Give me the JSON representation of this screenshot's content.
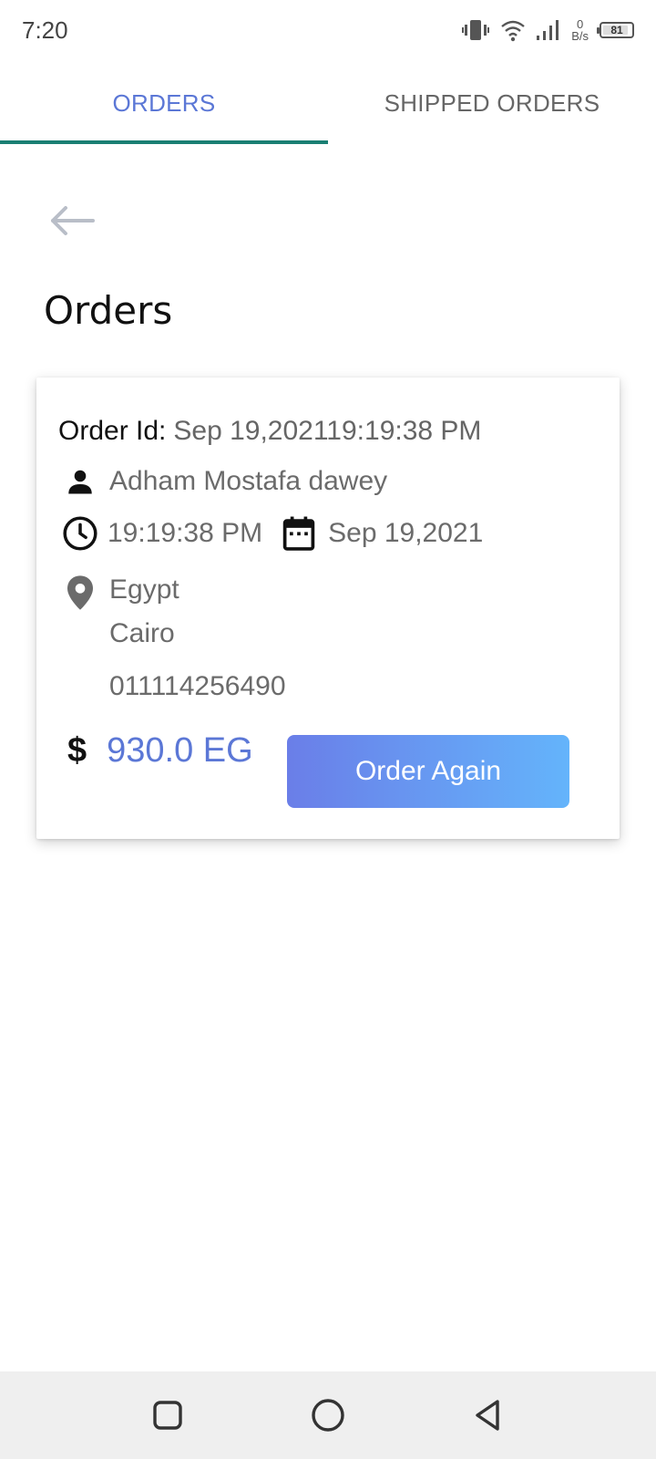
{
  "status_bar": {
    "time": "7:20",
    "net_speed_value": "0",
    "net_speed_unit": "B/s",
    "battery_level": "81"
  },
  "tabs": [
    {
      "label": "ORDERS",
      "active": true
    },
    {
      "label": "SHIPPED ORDERS",
      "active": false
    }
  ],
  "page": {
    "title": "Orders"
  },
  "order": {
    "id_label": "Order Id:",
    "id_value": "Sep 19,202119:19:38 PM",
    "customer_name": "Adham Mostafa dawey",
    "time": "19:19:38 PM",
    "date": "Sep 19,2021",
    "country": "Egypt",
    "city": "Cairo",
    "phone": "011114256490",
    "currency_symbol": "$",
    "price": "930.0 EG",
    "order_again_label": "Order Again"
  },
  "colors": {
    "accent": "#5b77d6",
    "tab_indicator": "#1a7f73",
    "button_gradient_start": "#6a7ee8",
    "button_gradient_end": "#64b4fb"
  },
  "icons": {
    "back": "arrow-left-icon",
    "person": "person-icon",
    "clock": "clock-icon",
    "calendar": "calendar-icon",
    "location": "location-pin-icon",
    "nav_recent": "square-icon",
    "nav_home": "circle-icon",
    "nav_back": "triangle-back-icon"
  }
}
